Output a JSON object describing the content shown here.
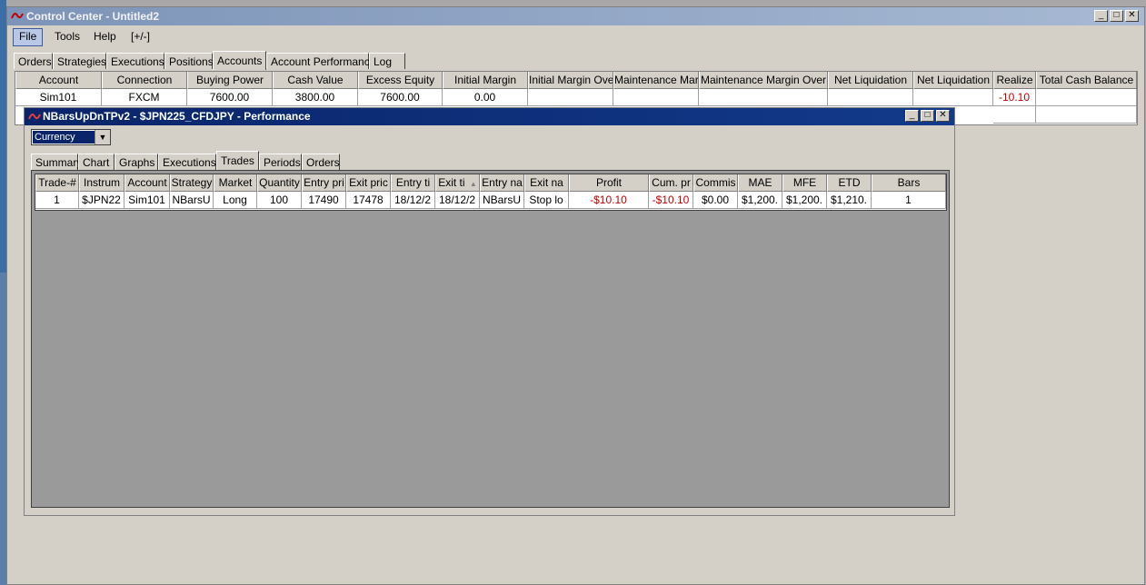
{
  "app": {
    "title": "Control Center - Untitled2",
    "window_buttons": {
      "minimize": "_",
      "maximize": "□",
      "close": "✕"
    }
  },
  "menu": [
    "File",
    "Tools",
    "Help",
    "[+/-]"
  ],
  "main_tabs": [
    "Orders",
    "Strategies",
    "Executions",
    "Positions",
    "Accounts",
    "Account Performance",
    "Log"
  ],
  "accounts_table": {
    "headers": [
      "Account",
      "Connection",
      "Buying Power",
      "Cash Value",
      "Excess Equity",
      "Initial Margin",
      "Initial Margin Ove",
      "Maintenance Mar",
      "Maintenance Margin Over",
      "Net Liquidation",
      "Net Liquidation",
      "Realize",
      "Total Cash Balance"
    ],
    "rows": [
      [
        "Sim101",
        "FXCM",
        "7600.00",
        "3800.00",
        "7600.00",
        "0.00",
        "",
        "",
        "",
        "",
        "",
        "-10.10",
        ""
      ]
    ]
  },
  "performance_window": {
    "title": "NBarsUpDnTPv2 - $JPN225_CFDJPY - Performance",
    "display_mode": "Currency",
    "tabs": [
      "Summary",
      "Chart",
      "Graphs",
      "Executions",
      "Trades",
      "Periods",
      "Orders"
    ],
    "trades_table": {
      "headers": [
        "Trade-#",
        "Instrum",
        "Account",
        "Strategy",
        "Market",
        "Quantity",
        "Entry pri",
        "Exit pric",
        "Entry ti",
        "Exit ti",
        "Entry na",
        "Exit na",
        "Profit",
        "Cum. pr",
        "Commis",
        "MAE",
        "MFE",
        "ETD",
        "Bars"
      ],
      "rows": [
        [
          "1",
          "$JPN22",
          "Sim101",
          "NBarsU",
          "Long",
          "100",
          "17490",
          "17478",
          "18/12/2",
          "18/12/2",
          "NBarsU",
          "Stop lo",
          "-$10.10",
          "-$10.10",
          "$0.00",
          "$1,200.",
          "$1,200.",
          "$1,210.",
          "1"
        ]
      ]
    }
  }
}
